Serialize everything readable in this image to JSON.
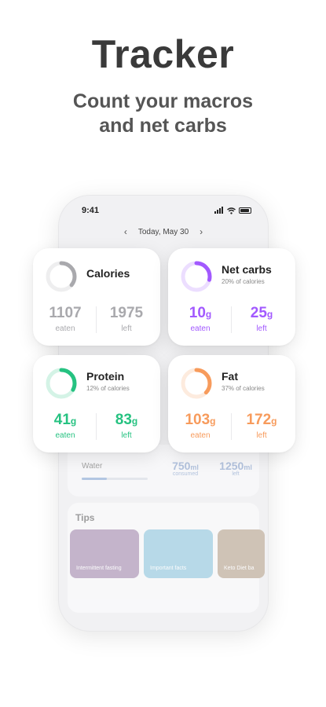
{
  "headline": "Tracker",
  "subheadline": [
    "Count your macros",
    "and net carbs"
  ],
  "status": {
    "time": "9:41"
  },
  "date": {
    "label": "Today, May 30",
    "prev_icon": "chevron-left-icon",
    "next_icon": "chevron-right-icon"
  },
  "cards": {
    "calories": {
      "title": "Calories",
      "subtitle": "",
      "eaten": "1107",
      "left": "1975",
      "eaten_label": "eaten",
      "left_label": "left",
      "color": "#a9a9ad",
      "progress": 0.36
    },
    "netcarbs": {
      "title": "Net carbs",
      "subtitle": "20% of calories",
      "eaten": "10",
      "left": "25",
      "unit": "g",
      "eaten_label": "eaten",
      "left_label": "left",
      "color": "#a259ff",
      "progress": 0.29
    },
    "protein": {
      "title": "Protein",
      "subtitle": "12% of calories",
      "eaten": "41",
      "left": "83",
      "unit": "g",
      "eaten_label": "eaten",
      "left_label": "left",
      "color": "#26c281",
      "progress": 0.33
    },
    "fat": {
      "title": "Fat",
      "subtitle": "37% of calories",
      "eaten": "103",
      "left": "172",
      "unit": "g",
      "eaten_label": "eaten",
      "left_label": "left",
      "color": "#f79b5c",
      "progress": 0.37
    }
  },
  "water": {
    "label": "Water",
    "consumed": "750",
    "consumed_label": "consumed",
    "left": "1250",
    "left_label": "left",
    "unit": "ml",
    "progress": 0.38,
    "color": "#9db3d6"
  },
  "tips": {
    "title": "Tips",
    "items": [
      {
        "label": "Intermittent fasting",
        "color": "#b9a6c2"
      },
      {
        "label": "Important facts",
        "color": "#a9d4e6"
      },
      {
        "label": "Keto Diet ba",
        "color": "#c7b8a8"
      }
    ]
  }
}
